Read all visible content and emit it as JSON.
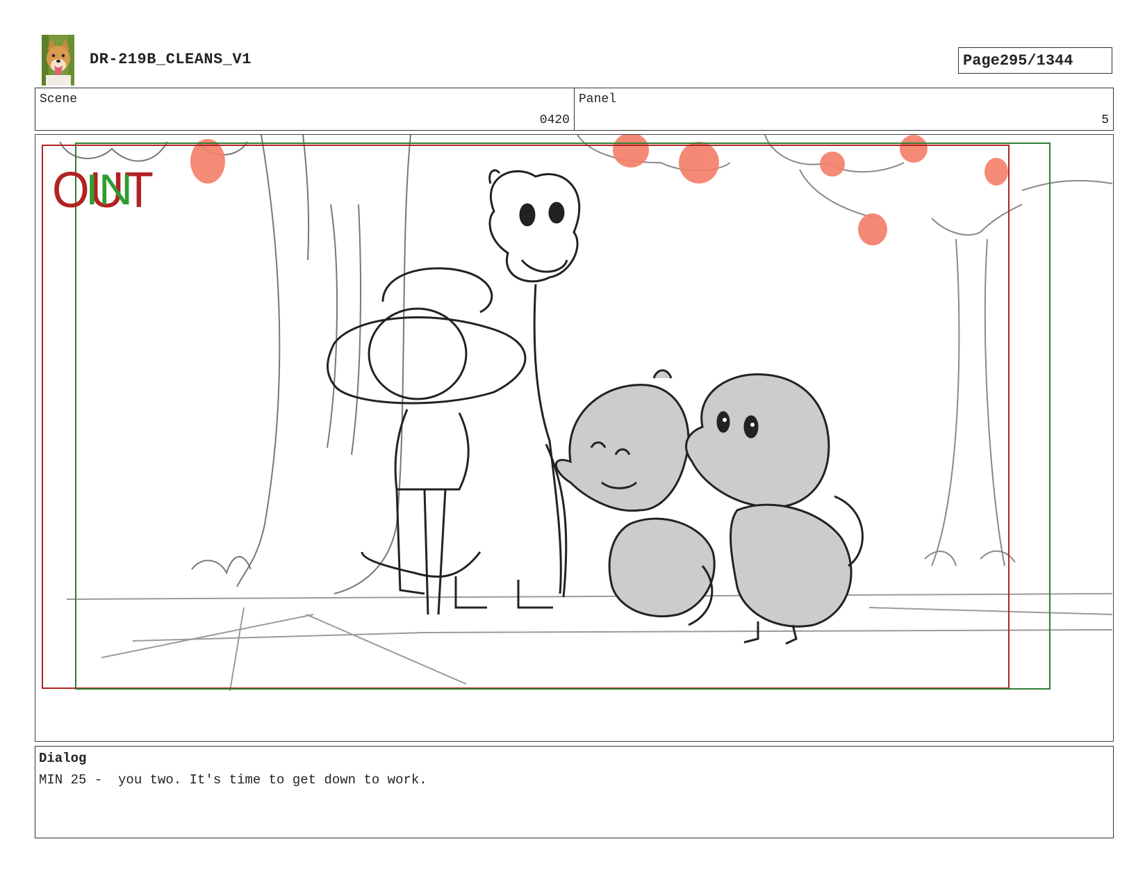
{
  "header": {
    "doc_title": "DR-219B_CLEANS_V1",
    "page_label": "Page",
    "page_value": "295/1344",
    "thumbnail_icon": "dog-avatar-icon"
  },
  "info": {
    "scene_label": "Scene",
    "scene_value": "0420",
    "panel_label": "Panel",
    "panel_value": "5"
  },
  "panel": {
    "out_label": "OUT",
    "in_label": "IN",
    "colors": {
      "out_frame": "#b22222",
      "in_frame": "#2e7d32",
      "apples": "#f4806b",
      "character_fill": "#cccccc",
      "ink": "#222222"
    }
  },
  "dialog": {
    "label": "Dialog",
    "text": "MIN 25 -  you two. It's time to get down to work."
  }
}
